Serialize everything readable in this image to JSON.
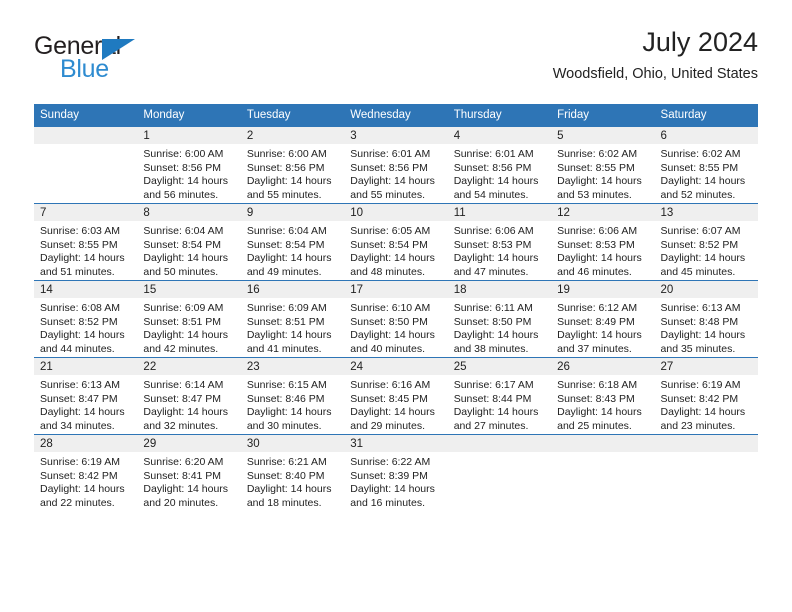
{
  "brand": {
    "name_top": "General",
    "name_bottom": "Blue",
    "triangle_color": "#1f7ac0",
    "top_text_color": "#231f20",
    "bottom_text_color": "#2e8bd0"
  },
  "header": {
    "title": "July 2024",
    "subtitle": "Woodsfield, Ohio, United States"
  },
  "theme": {
    "header_bg": "#2e75b6",
    "header_text": "#ffffff",
    "daynum_band_bg": "#efefef",
    "row_border": "#2e75b6",
    "body_text": "#222222"
  },
  "calendar": {
    "weekday_headers": [
      "Sunday",
      "Monday",
      "Tuesday",
      "Wednesday",
      "Thursday",
      "Friday",
      "Saturday"
    ],
    "weeks": [
      [
        {
          "day": "",
          "sunrise": "",
          "sunset": "",
          "daylight_line1": "",
          "daylight_line2": ""
        },
        {
          "day": "1",
          "sunrise": "Sunrise: 6:00 AM",
          "sunset": "Sunset: 8:56 PM",
          "daylight_line1": "Daylight: 14 hours",
          "daylight_line2": "and 56 minutes."
        },
        {
          "day": "2",
          "sunrise": "Sunrise: 6:00 AM",
          "sunset": "Sunset: 8:56 PM",
          "daylight_line1": "Daylight: 14 hours",
          "daylight_line2": "and 55 minutes."
        },
        {
          "day": "3",
          "sunrise": "Sunrise: 6:01 AM",
          "sunset": "Sunset: 8:56 PM",
          "daylight_line1": "Daylight: 14 hours",
          "daylight_line2": "and 55 minutes."
        },
        {
          "day": "4",
          "sunrise": "Sunrise: 6:01 AM",
          "sunset": "Sunset: 8:56 PM",
          "daylight_line1": "Daylight: 14 hours",
          "daylight_line2": "and 54 minutes."
        },
        {
          "day": "5",
          "sunrise": "Sunrise: 6:02 AM",
          "sunset": "Sunset: 8:55 PM",
          "daylight_line1": "Daylight: 14 hours",
          "daylight_line2": "and 53 minutes."
        },
        {
          "day": "6",
          "sunrise": "Sunrise: 6:02 AM",
          "sunset": "Sunset: 8:55 PM",
          "daylight_line1": "Daylight: 14 hours",
          "daylight_line2": "and 52 minutes."
        }
      ],
      [
        {
          "day": "7",
          "sunrise": "Sunrise: 6:03 AM",
          "sunset": "Sunset: 8:55 PM",
          "daylight_line1": "Daylight: 14 hours",
          "daylight_line2": "and 51 minutes."
        },
        {
          "day": "8",
          "sunrise": "Sunrise: 6:04 AM",
          "sunset": "Sunset: 8:54 PM",
          "daylight_line1": "Daylight: 14 hours",
          "daylight_line2": "and 50 minutes."
        },
        {
          "day": "9",
          "sunrise": "Sunrise: 6:04 AM",
          "sunset": "Sunset: 8:54 PM",
          "daylight_line1": "Daylight: 14 hours",
          "daylight_line2": "and 49 minutes."
        },
        {
          "day": "10",
          "sunrise": "Sunrise: 6:05 AM",
          "sunset": "Sunset: 8:54 PM",
          "daylight_line1": "Daylight: 14 hours",
          "daylight_line2": "and 48 minutes."
        },
        {
          "day": "11",
          "sunrise": "Sunrise: 6:06 AM",
          "sunset": "Sunset: 8:53 PM",
          "daylight_line1": "Daylight: 14 hours",
          "daylight_line2": "and 47 minutes."
        },
        {
          "day": "12",
          "sunrise": "Sunrise: 6:06 AM",
          "sunset": "Sunset: 8:53 PM",
          "daylight_line1": "Daylight: 14 hours",
          "daylight_line2": "and 46 minutes."
        },
        {
          "day": "13",
          "sunrise": "Sunrise: 6:07 AM",
          "sunset": "Sunset: 8:52 PM",
          "daylight_line1": "Daylight: 14 hours",
          "daylight_line2": "and 45 minutes."
        }
      ],
      [
        {
          "day": "14",
          "sunrise": "Sunrise: 6:08 AM",
          "sunset": "Sunset: 8:52 PM",
          "daylight_line1": "Daylight: 14 hours",
          "daylight_line2": "and 44 minutes."
        },
        {
          "day": "15",
          "sunrise": "Sunrise: 6:09 AM",
          "sunset": "Sunset: 8:51 PM",
          "daylight_line1": "Daylight: 14 hours",
          "daylight_line2": "and 42 minutes."
        },
        {
          "day": "16",
          "sunrise": "Sunrise: 6:09 AM",
          "sunset": "Sunset: 8:51 PM",
          "daylight_line1": "Daylight: 14 hours",
          "daylight_line2": "and 41 minutes."
        },
        {
          "day": "17",
          "sunrise": "Sunrise: 6:10 AM",
          "sunset": "Sunset: 8:50 PM",
          "daylight_line1": "Daylight: 14 hours",
          "daylight_line2": "and 40 minutes."
        },
        {
          "day": "18",
          "sunrise": "Sunrise: 6:11 AM",
          "sunset": "Sunset: 8:50 PM",
          "daylight_line1": "Daylight: 14 hours",
          "daylight_line2": "and 38 minutes."
        },
        {
          "day": "19",
          "sunrise": "Sunrise: 6:12 AM",
          "sunset": "Sunset: 8:49 PM",
          "daylight_line1": "Daylight: 14 hours",
          "daylight_line2": "and 37 minutes."
        },
        {
          "day": "20",
          "sunrise": "Sunrise: 6:13 AM",
          "sunset": "Sunset: 8:48 PM",
          "daylight_line1": "Daylight: 14 hours",
          "daylight_line2": "and 35 minutes."
        }
      ],
      [
        {
          "day": "21",
          "sunrise": "Sunrise: 6:13 AM",
          "sunset": "Sunset: 8:47 PM",
          "daylight_line1": "Daylight: 14 hours",
          "daylight_line2": "and 34 minutes."
        },
        {
          "day": "22",
          "sunrise": "Sunrise: 6:14 AM",
          "sunset": "Sunset: 8:47 PM",
          "daylight_line1": "Daylight: 14 hours",
          "daylight_line2": "and 32 minutes."
        },
        {
          "day": "23",
          "sunrise": "Sunrise: 6:15 AM",
          "sunset": "Sunset: 8:46 PM",
          "daylight_line1": "Daylight: 14 hours",
          "daylight_line2": "and 30 minutes."
        },
        {
          "day": "24",
          "sunrise": "Sunrise: 6:16 AM",
          "sunset": "Sunset: 8:45 PM",
          "daylight_line1": "Daylight: 14 hours",
          "daylight_line2": "and 29 minutes."
        },
        {
          "day": "25",
          "sunrise": "Sunrise: 6:17 AM",
          "sunset": "Sunset: 8:44 PM",
          "daylight_line1": "Daylight: 14 hours",
          "daylight_line2": "and 27 minutes."
        },
        {
          "day": "26",
          "sunrise": "Sunrise: 6:18 AM",
          "sunset": "Sunset: 8:43 PM",
          "daylight_line1": "Daylight: 14 hours",
          "daylight_line2": "and 25 minutes."
        },
        {
          "day": "27",
          "sunrise": "Sunrise: 6:19 AM",
          "sunset": "Sunset: 8:42 PM",
          "daylight_line1": "Daylight: 14 hours",
          "daylight_line2": "and 23 minutes."
        }
      ],
      [
        {
          "day": "28",
          "sunrise": "Sunrise: 6:19 AM",
          "sunset": "Sunset: 8:42 PM",
          "daylight_line1": "Daylight: 14 hours",
          "daylight_line2": "and 22 minutes."
        },
        {
          "day": "29",
          "sunrise": "Sunrise: 6:20 AM",
          "sunset": "Sunset: 8:41 PM",
          "daylight_line1": "Daylight: 14 hours",
          "daylight_line2": "and 20 minutes."
        },
        {
          "day": "30",
          "sunrise": "Sunrise: 6:21 AM",
          "sunset": "Sunset: 8:40 PM",
          "daylight_line1": "Daylight: 14 hours",
          "daylight_line2": "and 18 minutes."
        },
        {
          "day": "31",
          "sunrise": "Sunrise: 6:22 AM",
          "sunset": "Sunset: 8:39 PM",
          "daylight_line1": "Daylight: 14 hours",
          "daylight_line2": "and 16 minutes."
        },
        {
          "day": "",
          "sunrise": "",
          "sunset": "",
          "daylight_line1": "",
          "daylight_line2": ""
        },
        {
          "day": "",
          "sunrise": "",
          "sunset": "",
          "daylight_line1": "",
          "daylight_line2": ""
        },
        {
          "day": "",
          "sunrise": "",
          "sunset": "",
          "daylight_line1": "",
          "daylight_line2": ""
        }
      ]
    ]
  }
}
